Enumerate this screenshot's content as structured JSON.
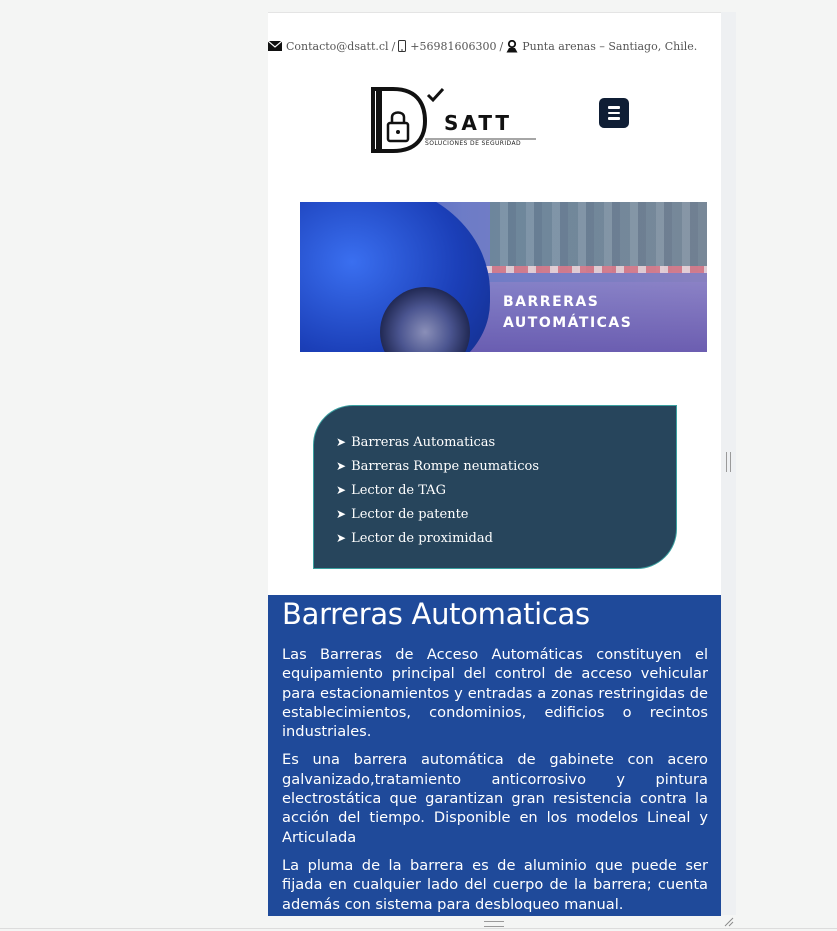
{
  "topbar": {
    "email": "Contacto@dsatt.cl",
    "phone": "+56981606300",
    "address": "Punta arenas – Santiago, Chile.",
    "separator": "/",
    "icons": [
      "mail-icon",
      "phone-icon",
      "location-icon"
    ]
  },
  "logo": {
    "name": "SATT",
    "tagline": "SOLUCIONES DE SEGURIDAD"
  },
  "banner": {
    "line1": "BARRERAS",
    "line2": "AUTOMÁTICAS"
  },
  "services": {
    "bullet": "➤",
    "items": [
      "Barreras Automaticas",
      "Barreras Rompe neumaticos",
      "Lector de TAG",
      "Lector de patente",
      "Lector de proximidad"
    ]
  },
  "section": {
    "title": "Barreras Automaticas",
    "paragraphs": [
      "Las Barreras de Acceso Automáticas constituyen el equipamiento principal del control de acceso vehicular para estacionamientos y entradas a zonas restringidas de establecimientos, condominios, edificios o recintos industriales.",
      "Es una barrera automática de gabinete con acero galvanizado,tratamiento anticorrosivo y pintura electrostática que garantizan gran resistencia contra la acción del tiempo. Disponible en los modelos Lineal y Articulada",
      "La pluma de la barrera es de aluminio que puede ser fijada en cualquier lado del cuerpo de la barrera; cuenta además con sistema para desbloqueo manual."
    ]
  },
  "colors": {
    "card_bg": "#27455c",
    "content_bg": "#1f4a9a",
    "menu_btn": "#0f1e35"
  }
}
